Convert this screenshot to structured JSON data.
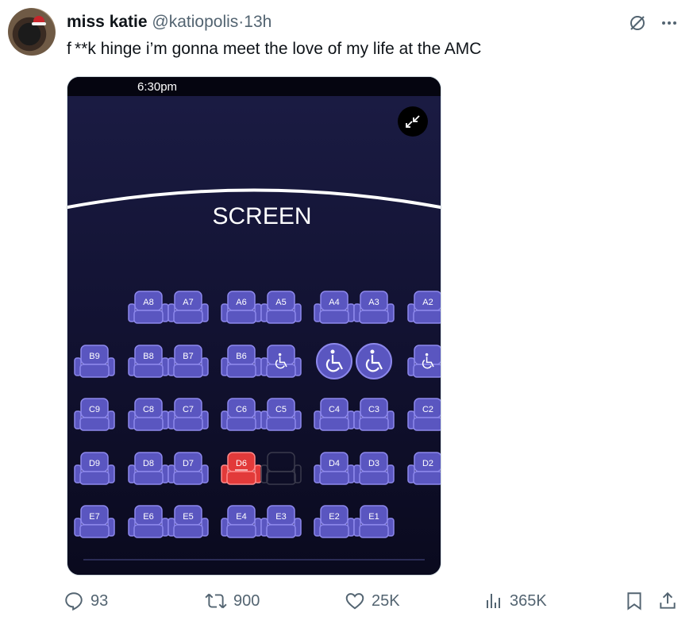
{
  "tweet": {
    "display_name": "miss katie",
    "handle": "@katiopolis",
    "separator": "·",
    "time": "13h",
    "text": "f **k hinge i’m gonna meet the love of my life at the AMC"
  },
  "media": {
    "status_time": "6:30pm",
    "screen_label": "SCREEN",
    "seats": {
      "row_a": [
        "A8",
        "A7",
        "A6",
        "A5",
        "A4",
        "A3",
        "A2"
      ],
      "row_b": [
        "B9",
        "B8",
        "B7",
        "B6",
        "",
        "",
        "",
        ""
      ],
      "row_c": [
        "C9",
        "C8",
        "C7",
        "C6",
        "C5",
        "C4",
        "C3",
        "C2"
      ],
      "row_d": [
        "D9",
        "D8",
        "D7",
        "D6",
        "",
        "D4",
        "D3",
        "D2"
      ],
      "row_e": [
        "E7",
        "E6",
        "E5",
        "E4",
        "E3",
        "E2",
        "E1"
      ]
    },
    "selected_seat": "D6",
    "colors": {
      "background": "#0f1030",
      "seat": "#5a56c0",
      "seat_outline": "#8d88ec",
      "selected": "#e23a3a",
      "screen_line": "#ffffff"
    }
  },
  "actions": {
    "replies": "93",
    "reposts": "900",
    "likes": "25K",
    "views": "365K"
  },
  "icons": [
    "grok-icon",
    "more-icon",
    "minimize-icon",
    "wheelchair-icon",
    "reply-icon",
    "repost-icon",
    "like-icon",
    "views-icon",
    "bookmark-icon",
    "share-icon"
  ]
}
